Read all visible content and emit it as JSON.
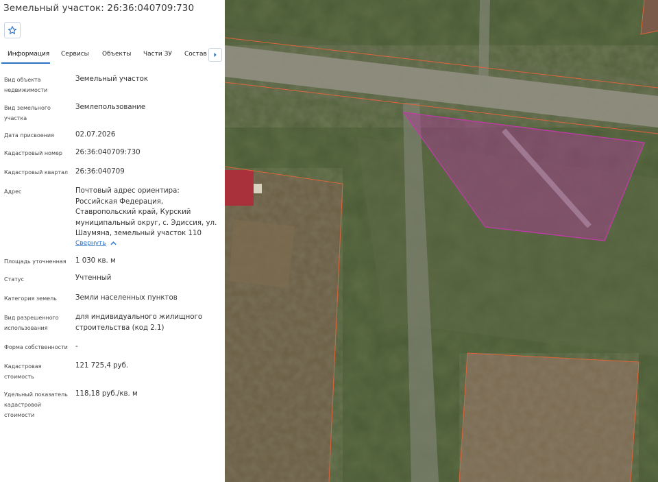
{
  "header": {
    "title": "Земельный участок: 26:36:040709:730"
  },
  "favorite_icon": "star-outline-icon",
  "tabs": [
    {
      "label": "Информация",
      "active": true
    },
    {
      "label": "Сервисы",
      "active": false
    },
    {
      "label": "Объекты",
      "active": false
    },
    {
      "label": "Части ЗУ",
      "active": false
    },
    {
      "label": "Состав",
      "active": false
    }
  ],
  "tab_next_icon": "chevron-right-icon",
  "info": {
    "object_type": {
      "label": "Вид объекта недвижимости",
      "value": "Земельный участок"
    },
    "land_type": {
      "label": "Вид земельного участка",
      "value": "Землепользование"
    },
    "assign_date": {
      "label": "Дата присвоения",
      "value": "02.07.2026"
    },
    "cadastral_number": {
      "label": "Кадастровый номер",
      "value": "26:36:040709:730"
    },
    "cadastral_quarter": {
      "label": "Кадастровый квартал",
      "value": "26:36:040709"
    },
    "address": {
      "label": "Адрес",
      "value": "Почтовый адрес ориентира: Российская Федерация, Ставропольский край, Курский муниципальный округ, с. Эдиссия, ул. Шаумяна, земельный участок 110",
      "collapse_label": "Свернуть"
    },
    "area": {
      "label": "Площадь уточненная",
      "value": "1 030 кв. м"
    },
    "status": {
      "label": "Статус",
      "value": "Учтенный"
    },
    "land_category": {
      "label": "Категория земель",
      "value": "Земли населенных пунктов"
    },
    "permitted_use": {
      "label": "Вид разрешенного использования",
      "value": "для индивидуального жилищного строительства (код 2.1)"
    },
    "ownership": {
      "label": "Форма собственности",
      "value": "-"
    },
    "cadastral_value": {
      "label": "Кадастровая стоимость",
      "value": "121 725,4 руб."
    },
    "specific_value": {
      "label": "Удельный показатель кадастровой стоимости",
      "value": "118,18 руб./кв. м"
    }
  },
  "colors": {
    "accent": "#2b72c4",
    "parcel_boundary": "#e0643a",
    "selected_parcel": "#c03aa8"
  }
}
